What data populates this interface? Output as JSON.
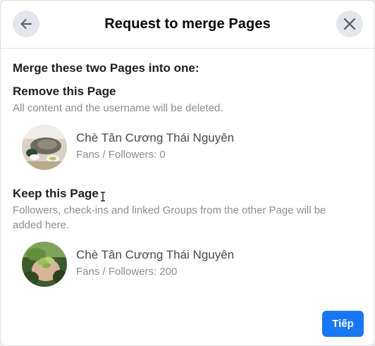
{
  "header": {
    "title": "Request to merge Pages"
  },
  "merge_heading": "Merge these two Pages into one:",
  "remove_section": {
    "title": "Remove this Page",
    "description": "All content and the username will be deleted.",
    "page": {
      "name": "Chè Tân Cương Thái Nguyên",
      "fans": "Fans / Followers: 0"
    }
  },
  "keep_section": {
    "title": "Keep this Page",
    "description": "Followers, check-ins and linked Groups from the other Page will be added here.",
    "page": {
      "name": "Chè Tân Cương Thái Nguyên",
      "fans": "Fans / Followers: 200"
    }
  },
  "footer": {
    "next_label": "Tiếp"
  },
  "icons": {
    "back": "arrow-left-icon",
    "close": "close-icon"
  },
  "colors": {
    "accent": "#1877f2",
    "icon_button_bg": "#e4e6eb",
    "secondary_text": "#8a8d91"
  }
}
